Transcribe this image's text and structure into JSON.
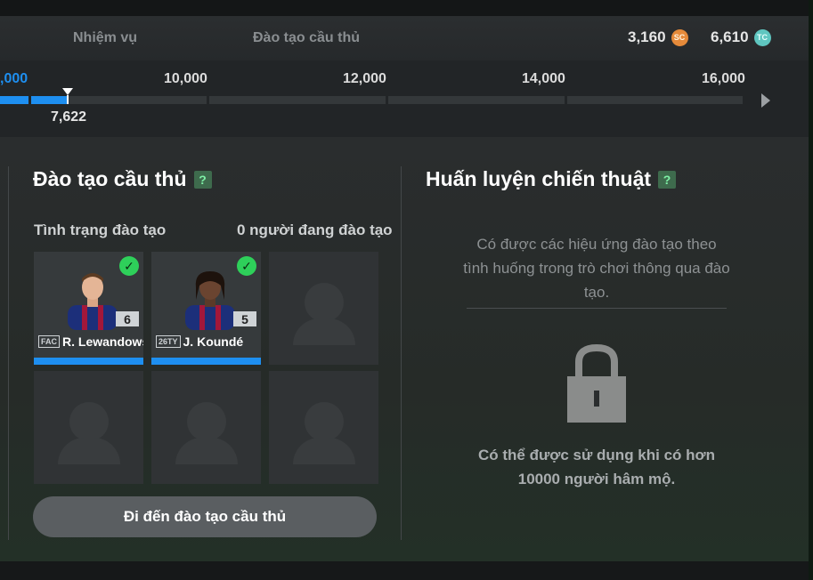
{
  "header": {
    "nav": [
      "Nhiệm vụ",
      "Đào tạo cầu thủ"
    ],
    "currency": [
      {
        "value": "3,160",
        "icon": "SC"
      },
      {
        "value": "6,610",
        "icon": "TC"
      }
    ]
  },
  "progress": {
    "ticks": [
      ",000",
      "10,000",
      "12,000",
      "14,000",
      "16,000"
    ],
    "current_value": "7,622"
  },
  "training": {
    "title": "Đào tạo cầu thủ",
    "help": "?",
    "status_label": "Tình trạng đào tạo",
    "count_label": "0 người đang đào tạo",
    "players": [
      {
        "name": "R. Lewandows",
        "badge": "FAC",
        "level": "6"
      },
      {
        "name": "J. Koundé",
        "badge": "26TY",
        "level": "5"
      }
    ],
    "button_label": "Đi đến đào tạo cầu thủ"
  },
  "tactics": {
    "title": "Huấn luyện chiến thuật",
    "help": "?",
    "description": "Có được các hiệu ứng đào tạo theo tình huống trong trò chơi thông qua đào tạo.",
    "lock_message": "Có thể được sử dụng khi có hơn 10000 người hâm mộ."
  },
  "colors": {
    "accent": "#1e8ff0",
    "check": "#2ed05a"
  }
}
